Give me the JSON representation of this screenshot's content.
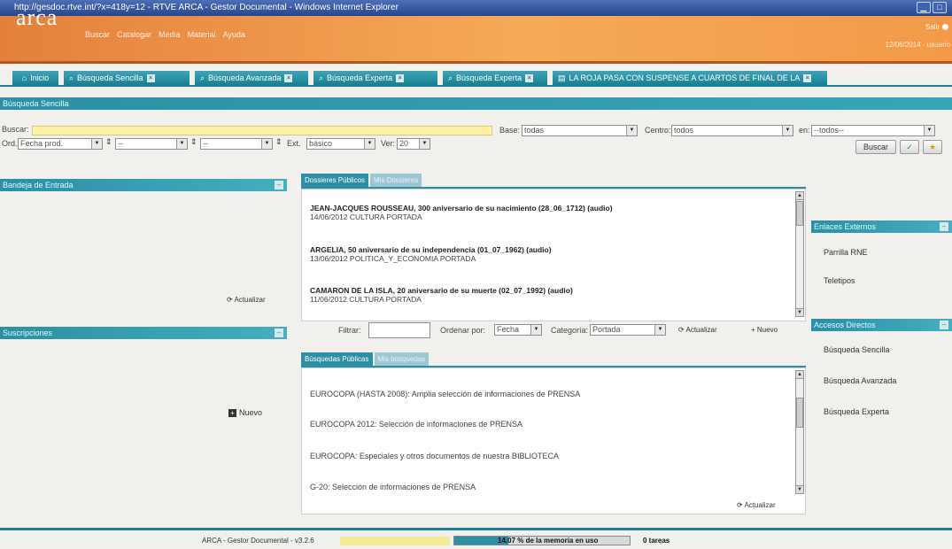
{
  "window": {
    "title": "http://gesdoc.rtve.int/?x=418y=12 - RTVE ARCA - Gestor Documental - Windows Internet Explorer"
  },
  "header": {
    "logo": "arca",
    "menu": [
      "Buscar",
      "Catalogar",
      "Media",
      "Material",
      "Ayuda"
    ],
    "salir": "Salir",
    "user": "12/06/2014 · usuario"
  },
  "tabs": [
    {
      "label": "Inicio",
      "closable": false
    },
    {
      "label": "Búsqueda Sencilla",
      "closable": true
    },
    {
      "label": "Búsqueda Avanzada",
      "closable": true
    },
    {
      "label": "Búsqueda Experta",
      "closable": true
    },
    {
      "label": "Búsqueda Experta",
      "closable": true
    },
    {
      "label": "LA ROJA PASA CON SUSPENSE A CUARTOS DE FINAL DE LA",
      "closable": true
    }
  ],
  "search": {
    "section_title": "Búsqueda Sencilla",
    "buscar_label": "Buscar:",
    "buscar_value": "",
    "base_label": "Base:",
    "base_value": "todas",
    "centro_label": "Centro:",
    "centro_value": "todos",
    "en_label": "en:",
    "en_value": "--todos--",
    "ord_label": "Ord.",
    "ord_value": "Fecha prod.",
    "ord2_value": "--",
    "ord3_value": "--",
    "ext_label": "Ext.",
    "ext_value": "básico",
    "ver_label": "Ver:",
    "ver_value": "20",
    "buscar_button": "Buscar"
  },
  "left": {
    "bandeja_title": "Bandeja de Entrada",
    "actualizar": "Actualizar",
    "suscripciones_title": "Suscripciones",
    "nuevo": "Nuevo"
  },
  "dossiers": {
    "tab_active": "Dossieres Públicos",
    "tab_inactive": "Mis Dossieres",
    "items": [
      {
        "title": "JEAN-JACQUES ROUSSEAU, 300 aniversario de su nacimiento (28_06_1712) (audio)",
        "sub": "14/06/2012 CULTURA PORTADA"
      },
      {
        "title": "ARGELIA, 50 aniversario de su independencia (01_07_1962) (audio)",
        "sub": "13/06/2012 POLITICA_Y_ECONOMIA PORTADA"
      },
      {
        "title": "CAMARON DE LA ISLA, 20 aniversario de su muerte (02_07_1992) (audio)",
        "sub": "11/06/2012 CULTURA PORTADA"
      }
    ],
    "filtrar_label": "Filtrar:",
    "ordenar_label": "Ordenar por:",
    "ordenar_value": "Fecha",
    "categoria_label": "Categoría:",
    "categoria_value": "Portada",
    "actualizar": "Actualizar",
    "nuevo": "Nuevo"
  },
  "busquedas": {
    "tab_active": "Búsquedas Públicas",
    "tab_inactive": "Mis búsquedas",
    "items": [
      "EUROCOPA (HASTA 2008): Amplia selección de informaciones de PRENSA",
      "EUROCOPA 2012: Selección de informaciones de PRENSA",
      "EUROCOPA: Especiales y otros documentos de nuestra BIBLIOTECA",
      "G-20: Selección de informaciones de PRENSA"
    ],
    "actualizar": "Actualizar"
  },
  "right": {
    "enlaces_title": "Enlaces Externos",
    "enlaces": [
      "Parrilla RNE",
      "Teletipos"
    ],
    "accesos_title": "Accesos Directos",
    "accesos": [
      "Búsqueda Sencilla",
      "Búsqueda Avanzada",
      "Búsqueda Experta"
    ]
  },
  "status": {
    "version": "ARCA - Gestor Documental - v3.2.6",
    "memory": "14.07 % de la memoria en uso",
    "memory_fraction": 0.1407,
    "tasks": "0 tareas"
  },
  "colors": {
    "accent": "#2c8fa4",
    "header": "#f29a48",
    "searchbox": "#fdf2a8"
  }
}
